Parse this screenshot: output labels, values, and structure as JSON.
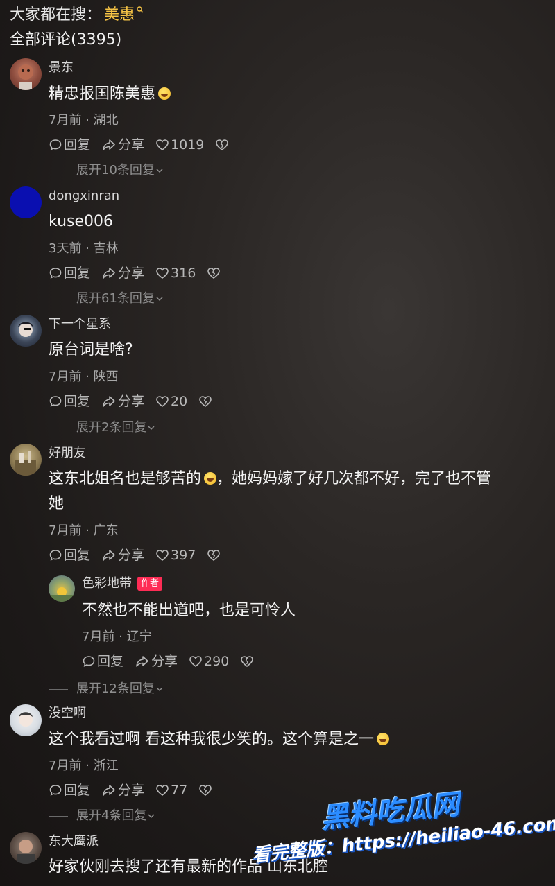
{
  "hot_search": {
    "prefix": "大家都在搜：",
    "keyword": "美惠"
  },
  "comment_count_label": "全部评论(3395)",
  "action_labels": {
    "reply": "回复",
    "share": "分享"
  },
  "comments": [
    {
      "username": "景东",
      "content": "精忠报国陈美惠",
      "meta": "7月前 · 湖北",
      "likes": "1019",
      "expand": "展开10条回复"
    },
    {
      "username": "dongxinran",
      "content": "kuse006",
      "meta": "3天前 · 吉林",
      "likes": "316",
      "expand": "展开61条回复"
    },
    {
      "username": "下一个星系",
      "content": "原台词是啥?",
      "meta": "7月前 · 陕西",
      "likes": "20",
      "expand": "展开2条回复"
    },
    {
      "username": "好朋友",
      "content_line1": "这东北姐名也是够苦的",
      "content_line1b": "，她妈妈嫁了好几次都不好，完了也不管",
      "content_line2": "她",
      "meta": "7月前 · 广东",
      "likes": "397",
      "reply": {
        "username": "色彩地带",
        "author_tag": "作者",
        "content": "不然也不能出道吧，也是可怜人",
        "meta": "7月前 · 辽宁",
        "likes": "290"
      },
      "expand": "展开12条回复"
    },
    {
      "username": "没空啊",
      "content": "这个我看过啊 看这种我很少笑的。这个算是之一",
      "meta": "7月前 · 浙江",
      "likes": "77",
      "expand": "展开4条回复"
    },
    {
      "username": "东大鹰派",
      "content": "好家伙刚去搜了还有最新的作品 山东北腔"
    }
  ],
  "watermark": {
    "brand": "黑料吃瓜网",
    "url": "看完整版：https://heiliao-46.com"
  },
  "colors": {
    "keyword": "#f6c445",
    "author_tag": "#fe2c55",
    "watermark_blue": "#2b8cff"
  }
}
